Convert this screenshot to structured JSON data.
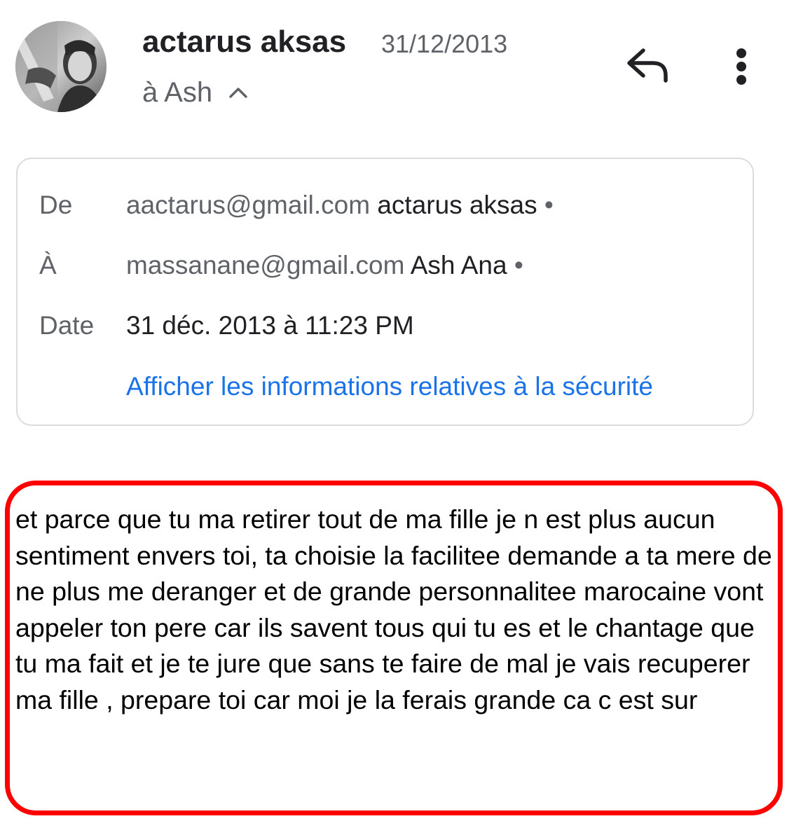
{
  "header": {
    "sender_name": "actarus aksas",
    "date": "31/12/2013",
    "recipient_summary": "à Ash",
    "icons": {
      "avatar": "profile-photo",
      "toggle": "chevron-up-icon",
      "reply": "reply-arrow-icon",
      "more": "more-vertical-icon"
    }
  },
  "details": {
    "from_label": "De",
    "from_email": "aactarus@gmail.com",
    "from_name": "actarus aksas",
    "to_label": "À",
    "to_email": "massanane@gmail.com",
    "to_name": "Ash Ana",
    "separator": "•",
    "date_label": "Date",
    "date_value": "31 déc. 2013 à 11:23 PM",
    "security_link": "Afficher les informations relatives à la sécurité"
  },
  "message": {
    "body": "et parce que tu ma retirer tout de ma fille je n est plus aucun sentiment envers toi, ta choisie la facilitee demande a ta mere de ne plus me deranger et de grande personnalitee marocaine vont appeler ton pere car ils savent tous qui tu es et le chantage que tu ma fait et je te jure que sans te faire de mal je vais recuperer ma fille , prepare toi car moi je la ferais grande ca c est sur"
  },
  "colors": {
    "highlight_border": "#ff0000",
    "link": "#1a73e8",
    "secondary_text": "#5f6368",
    "card_border": "#dadce0"
  }
}
